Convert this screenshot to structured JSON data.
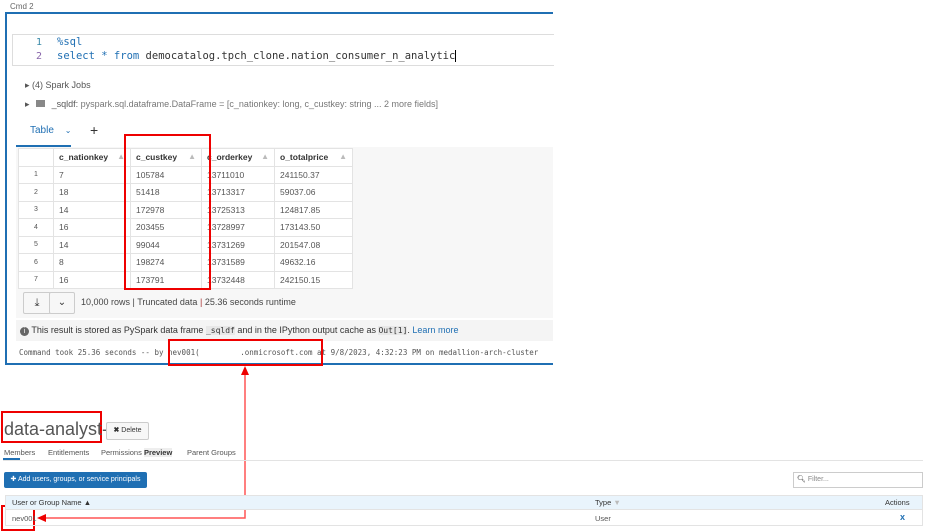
{
  "cell": {
    "label": "Cmd 2",
    "lines": [
      {
        "n": "1",
        "text": "%sql"
      },
      {
        "n": "2",
        "kw1": "select",
        "star": "*",
        "kw2": "from",
        "rest": "democatalog.tpch_clone.nation_consumer_n_analytic"
      }
    ],
    "spark_jobs": "(4) Spark Jobs",
    "sqldf_name": "_sqldf:",
    "sqldf_type": "pyspark.sql.dataframe.DataFrame = [c_nationkey: long, c_custkey: string ... 2 more fields]"
  },
  "result": {
    "tab": "Table",
    "add": "+",
    "columns": [
      "c_nationkey",
      "c_custkey",
      "c_orderkey",
      "o_totalprice"
    ],
    "rows": [
      [
        "1",
        "7",
        "105784",
        "13711010",
        "241150.37"
      ],
      [
        "2",
        "18",
        "51418",
        "13713317",
        "59037.06"
      ],
      [
        "3",
        "14",
        "172978",
        "13725313",
        "124817.85"
      ],
      [
        "4",
        "16",
        "203455",
        "13728997",
        "173143.50"
      ],
      [
        "5",
        "14",
        "99044",
        "13731269",
        "201547.08"
      ],
      [
        "6",
        "8",
        "198274",
        "13731589",
        "49632.16"
      ],
      [
        "7",
        "16",
        "173791",
        "13732448",
        "242150.15"
      ]
    ],
    "summary": {
      "rows": "10,000 rows",
      "truncated": "Truncated data",
      "runtime": "25.36 seconds runtime"
    },
    "info": {
      "pre": "This result is stored as PySpark data frame",
      "df": "_sqldf",
      "mid": "and in the IPython output cache as",
      "out": "Out[1]",
      "post": ".",
      "link": "Learn more"
    },
    "command_took": {
      "pre": "Command took 25.36 seconds -- by",
      "user": "nev001(",
      "domain": ".onmicrosoft.com",
      "post": "at 9/8/2023, 4:32:23 PM on medallion-arch-cluster"
    }
  },
  "group": {
    "title": "data-analyst-gr",
    "delete": "Delete",
    "tabs": [
      "Members",
      "Entitlements",
      "Permissions",
      "Parent Groups"
    ],
    "preview": "Preview",
    "add_button": "Add users, groups, or service principals",
    "filter_placeholder": "Filter...",
    "columns": [
      "User or Group Name",
      "Type",
      "Actions"
    ],
    "rows": [
      {
        "name": "nev001",
        "type": "User",
        "action": "x"
      }
    ]
  },
  "colors": {
    "accent": "#1f6fb3",
    "highlight": "#e00000"
  }
}
